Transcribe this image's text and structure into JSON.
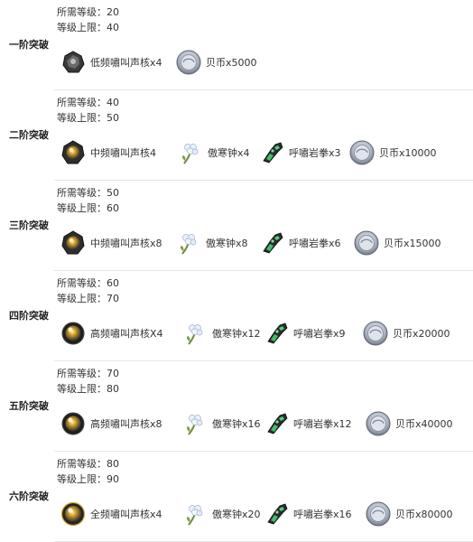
{
  "labels": {
    "req_level": "所需等级：",
    "level_cap": "等级上限："
  },
  "icons": {
    "core-low": "low-frequency-howl-core-icon",
    "core-mid": "mid-frequency-howl-core-icon",
    "core-high": "high-frequency-howl-core-icon",
    "core-full": "full-frequency-howl-core-icon",
    "flower": "aohan-bell-flower-icon",
    "gauntlet": "howling-rock-fist-icon",
    "coin": "shell-coin-icon"
  },
  "tiers": [
    {
      "name": "一阶突破",
      "req_level": "20",
      "level_cap": "40",
      "items": [
        {
          "icon": "core-low",
          "text": "低频嘯叫声核x4"
        },
        {
          "icon": "coin",
          "text": "贝币x5000"
        }
      ]
    },
    {
      "name": "二阶突破",
      "req_level": "40",
      "level_cap": "50",
      "items": [
        {
          "icon": "core-mid",
          "text": "中频嘯叫声核4"
        },
        {
          "icon": "flower",
          "text": "傲寒钟x4"
        },
        {
          "icon": "gauntlet",
          "text": "呼嘯岩拳x3"
        },
        {
          "icon": "coin",
          "text": "贝币x10000"
        }
      ]
    },
    {
      "name": "三阶突破",
      "req_level": "50",
      "level_cap": "60",
      "items": [
        {
          "icon": "core-mid",
          "text": "中频嘯叫声核x8"
        },
        {
          "icon": "flower",
          "text": "傲寒钟x8"
        },
        {
          "icon": "gauntlet",
          "text": "呼嘯岩拳x6"
        },
        {
          "icon": "coin",
          "text": "贝币x15000"
        }
      ]
    },
    {
      "name": "四阶突破",
      "req_level": "60",
      "level_cap": "70",
      "items": [
        {
          "icon": "core-high",
          "text": "高频嘯叫声核X4"
        },
        {
          "icon": "flower",
          "text": "傲寒钟x12"
        },
        {
          "icon": "gauntlet",
          "text": "呼嘯岩拳x9"
        },
        {
          "icon": "coin",
          "text": "贝币x20000"
        }
      ]
    },
    {
      "name": "五阶突破",
      "req_level": "70",
      "level_cap": "80",
      "items": [
        {
          "icon": "core-high",
          "text": "高频嘯叫声核x8"
        },
        {
          "icon": "flower",
          "text": "傲寒钟x16"
        },
        {
          "icon": "gauntlet",
          "text": "呼嘯岩拳x12"
        },
        {
          "icon": "coin",
          "text": "贝币x40000"
        }
      ]
    },
    {
      "name": "六阶突破",
      "req_level": "80",
      "level_cap": "90",
      "items": [
        {
          "icon": "core-full",
          "text": "全频嘯叫声核x4"
        },
        {
          "icon": "flower",
          "text": "傲寒钟x20"
        },
        {
          "icon": "gauntlet",
          "text": "呼嘯岩拳x16"
        },
        {
          "icon": "coin",
          "text": "贝币x80000"
        }
      ]
    }
  ]
}
